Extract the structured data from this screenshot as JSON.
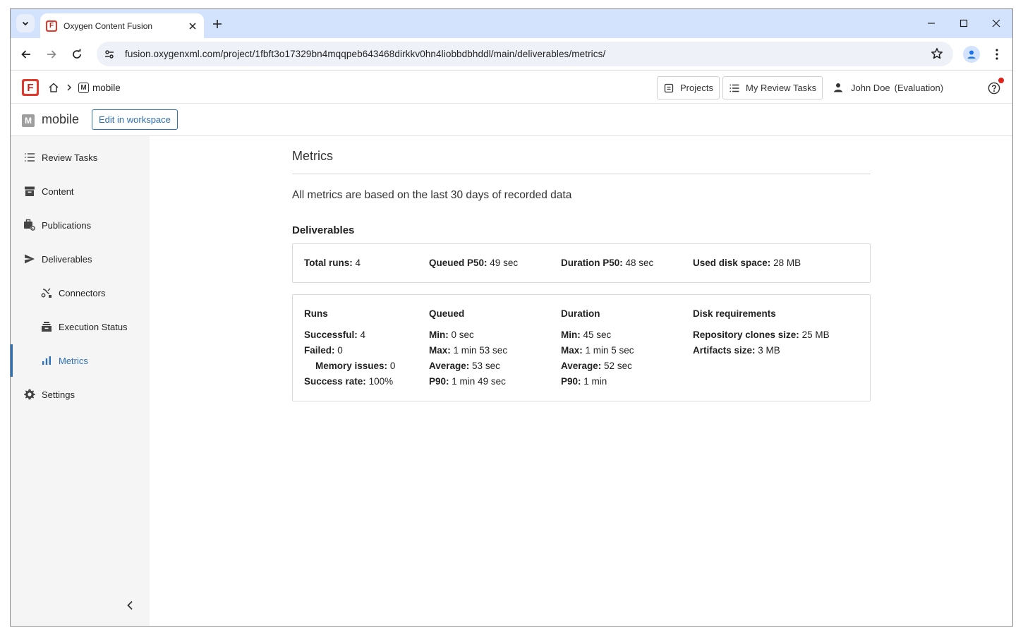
{
  "browser": {
    "tab_title": "Oxygen Content Fusion",
    "url": "fusion.oxygenxml.com/project/1fbft3o17329bn4mqqpeb643468dirkkv0hn4liobbdbhddl/main/deliverables/metrics/"
  },
  "header": {
    "breadcrumb_project": "mobile",
    "breadcrumb_badge": "M",
    "projects_label": "Projects",
    "review_tasks_label": "My Review Tasks",
    "user_name": "John Doe",
    "user_note": "(Evaluation)"
  },
  "project_bar": {
    "badge": "M",
    "name": "mobile",
    "edit_label": "Edit in workspace"
  },
  "sidebar": {
    "items": [
      {
        "label": "Review Tasks",
        "icon": "list-icon"
      },
      {
        "label": "Content",
        "icon": "archive-icon"
      },
      {
        "label": "Publications",
        "icon": "publications-icon"
      },
      {
        "label": "Deliverables",
        "icon": "send-icon"
      },
      {
        "label": "Connectors",
        "icon": "connectors-icon"
      },
      {
        "label": "Execution Status",
        "icon": "execution-icon"
      },
      {
        "label": "Metrics",
        "icon": "bar-chart-icon"
      },
      {
        "label": "Settings",
        "icon": "gear-icon"
      }
    ],
    "active": "Metrics"
  },
  "main": {
    "title": "Metrics",
    "intro": "All metrics are based on the last 30 days of recorded data",
    "section_title": "Deliverables",
    "summary": {
      "total_runs": {
        "label": "Total runs:",
        "value": "4"
      },
      "queued_p50": {
        "label": "Queued P50:",
        "value": "49 sec"
      },
      "duration_p50": {
        "label": "Duration P50:",
        "value": "48 sec"
      },
      "disk_space": {
        "label": "Used disk space:",
        "value": "28 MB"
      }
    },
    "runs": {
      "heading": "Runs",
      "successful": {
        "label": "Successful:",
        "value": "4"
      },
      "failed": {
        "label": "Failed:",
        "value": "0"
      },
      "memory_issues": {
        "label": "Memory issues:",
        "value": "0"
      },
      "success_rate": {
        "label": "Success rate:",
        "value": "100%"
      }
    },
    "queued": {
      "heading": "Queued",
      "min": {
        "label": "Min:",
        "value": "0 sec"
      },
      "max": {
        "label": "Max:",
        "value": "1 min 53 sec"
      },
      "average": {
        "label": "Average:",
        "value": "53 sec"
      },
      "p90": {
        "label": "P90:",
        "value": "1 min 49 sec"
      }
    },
    "duration": {
      "heading": "Duration",
      "min": {
        "label": "Min:",
        "value": "45 sec"
      },
      "max": {
        "label": "Max:",
        "value": "1 min 5 sec"
      },
      "average": {
        "label": "Average:",
        "value": "52 sec"
      },
      "p90": {
        "label": "P90:",
        "value": "1 min"
      }
    },
    "disk": {
      "heading": "Disk requirements",
      "repo_clones": {
        "label": "Repository clones size:",
        "value": "25 MB"
      },
      "artifacts": {
        "label": "Artifacts size:",
        "value": "3 MB"
      }
    }
  },
  "colors": {
    "accent": "#2f6fb4",
    "brand": "#e03a2f",
    "tabstrip": "#d3e3fd",
    "sidebar_bg": "#f5f5f5",
    "notification": "#e0221b"
  }
}
